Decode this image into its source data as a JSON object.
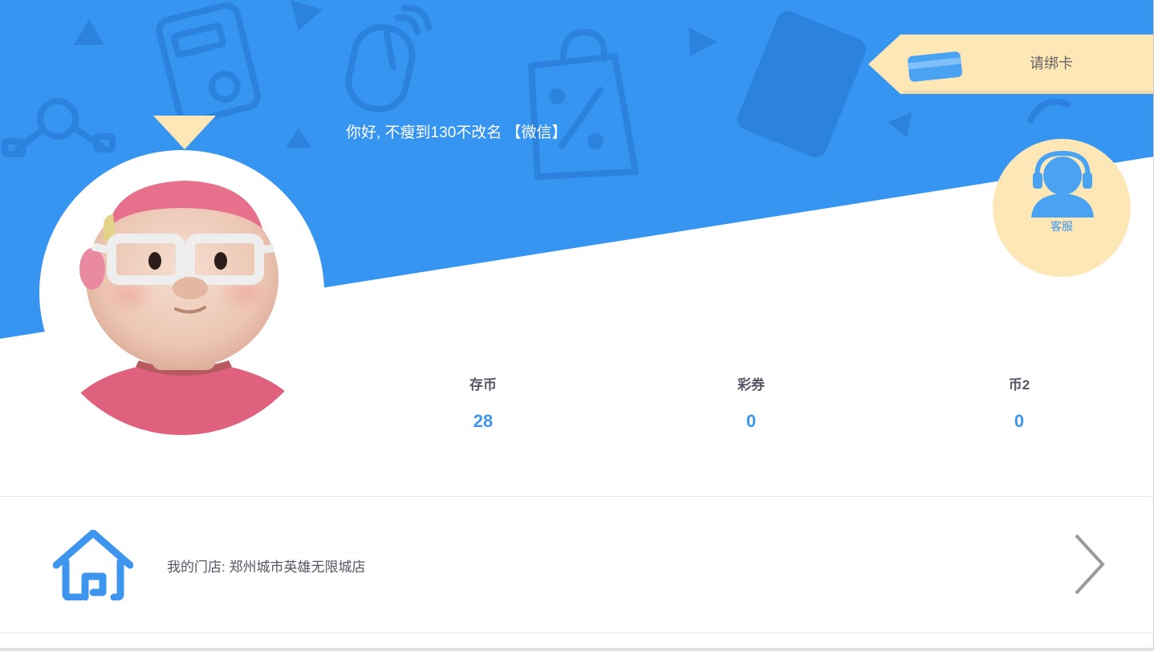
{
  "header": {
    "greeting": "你好, 不瘦到130不改名 【微信】",
    "bg_color": "#3795f2",
    "deco_color": "#2c82dd"
  },
  "bind_card": {
    "label": "请绑卡",
    "bg_color": "#fde7b7",
    "icon": "card-icon"
  },
  "service": {
    "label": "客服",
    "icon": "headset-agent-icon",
    "bg_color": "#fde7b7"
  },
  "avatar": {
    "icon": "cartoon-avatar"
  },
  "stats": [
    {
      "label": "存币",
      "value": "28"
    },
    {
      "label": "彩券",
      "value": "0"
    },
    {
      "label": "币2",
      "value": "0"
    }
  ],
  "store": {
    "text": "我的门店: 郑州城市英雄无限城店",
    "icon": "home-icon",
    "chevron": "chevron-right-icon"
  },
  "colors": {
    "accent": "#3d95ee",
    "stat_label": "#555566"
  }
}
